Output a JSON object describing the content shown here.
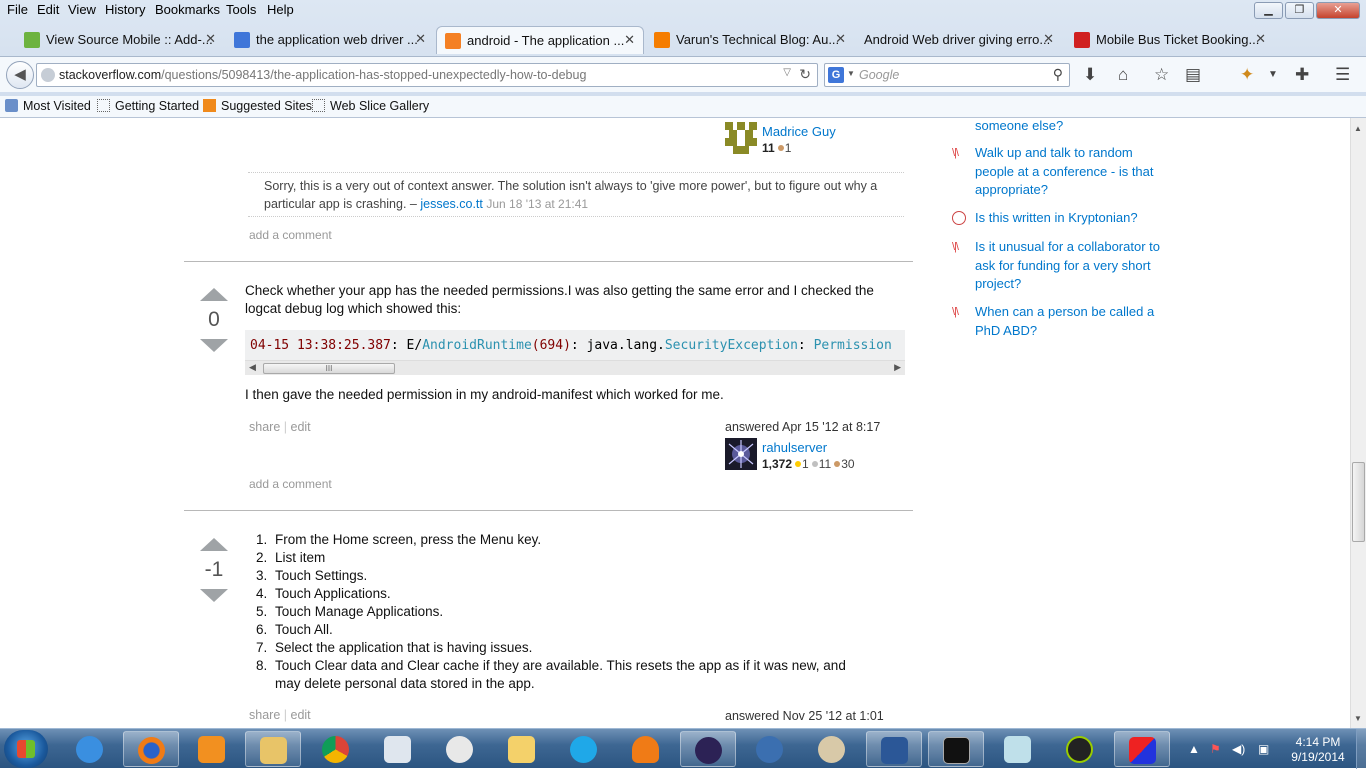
{
  "menu": [
    "File",
    "Edit",
    "View",
    "History",
    "Bookmarks",
    "Tools",
    "Help"
  ],
  "tabs": [
    {
      "label": "View Source Mobile :: Add-...",
      "icon": "puzzle-icon",
      "color": "#6db33f"
    },
    {
      "label": "the application web driver ...",
      "icon": "google-icon",
      "color": "#3f76d9"
    },
    {
      "label": "android - The application ...",
      "icon": "stackoverflow-icon",
      "color": "#f48024"
    },
    {
      "label": "Varun's Technical Blog: Au...",
      "icon": "blogger-icon",
      "color": "#f57d00"
    },
    {
      "label": "Android Web driver giving erro...",
      "icon": "blank-page-icon",
      "color": "#ffffff"
    },
    {
      "label": "Mobile Bus Ticket Booking...",
      "icon": "bus-icon",
      "color": "#d02020"
    }
  ],
  "url": {
    "host": "stackoverflow.com",
    "path": "/questions/5098413/the-application-has-stopped-unexpectedly-how-to-debug"
  },
  "search": {
    "placeholder": "Google",
    "engine": "G"
  },
  "bookmarks": [
    "Most Visited",
    "Getting Started",
    "Suggested Sites",
    "Web Slice Gallery"
  ],
  "post_top": {
    "user": {
      "name": "Madrice Guy",
      "rep": "11",
      "bronze": "1"
    },
    "comment": {
      "text": "Sorry, this is a very out of context answer. The solution isn't always to 'give more power', but to figure out why a particular app is crashing. –",
      "author": "jesses.co.tt",
      "time": "Jun 18 '13 at 21:41"
    },
    "add_comment": "add a comment"
  },
  "answer1": {
    "votes": "0",
    "text1": "Check whether your app has the needed permissions.I was also getting the same error and I checked the logcat debug log which showed this:",
    "code": {
      "ts": "04-15 13:38:25.387",
      "level": ": E/",
      "tag": "AndroidRuntime",
      "pid": "(694)",
      "mid": ": java.lang.",
      "exc": "SecurityException",
      "colon": ":",
      "perm": "Permission"
    },
    "text2": "I then gave the needed permission in my android-manifest which worked for me.",
    "share": "share",
    "edit": "edit",
    "answered": "answered Apr 15 '12 at 8:17",
    "user": {
      "name": "rahulserver",
      "rep": "1,372",
      "gold": "1",
      "silver": "11",
      "bronze": "30"
    },
    "add_comment": "add a comment"
  },
  "answer2": {
    "votes": "-1",
    "steps": [
      "From the Home screen, press the Menu key.",
      "List item",
      "Touch Settings.",
      "Touch Applications.",
      "Touch Manage Applications.",
      "Touch All.",
      "Select the application that is having issues.",
      "Touch Clear data and Clear cache if they are available. This resets the app as if it was new, and",
      "may delete personal data stored in the app."
    ],
    "share": "share",
    "edit": "edit",
    "answered": "answered Nov 25 '12 at 1:01"
  },
  "sidebar": [
    {
      "text": "someone else?",
      "icon": "academia-icon"
    },
    {
      "text": "Walk up and talk to random people at a conference - is that appropriate?",
      "icon": "academia-icon"
    },
    {
      "text": "Is this written in Kryptonian?",
      "icon": "puzzling-icon"
    },
    {
      "text": "Is it unusual for a collaborator to ask for funding for a very short project?",
      "icon": "academia-icon"
    },
    {
      "text": "When can a person be called a PhD ABD?",
      "icon": "academia-icon"
    }
  ],
  "clock": {
    "time": "4:14 PM",
    "date": "9/19/2014"
  },
  "taskbar_apps": [
    "internet-explorer",
    "firefox",
    "media-player",
    "file-explorer",
    "chrome",
    "calculator",
    "google-talk",
    "outlook",
    "skype",
    "sweet-home",
    "eclipse",
    "thunderbird",
    "paint",
    "word",
    "command-prompt",
    "notepad",
    "android-sdk",
    "virtualbox"
  ]
}
